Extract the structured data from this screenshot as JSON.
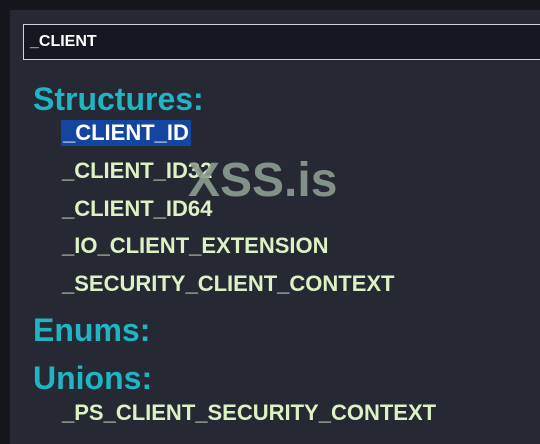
{
  "search": {
    "value": "_CLIENT"
  },
  "sections": {
    "structures": {
      "heading": "Structures:",
      "items": [
        "_CLIENT_ID",
        "_CLIENT_ID32",
        "_CLIENT_ID64",
        "_IO_CLIENT_EXTENSION",
        "_SECURITY_CLIENT_CONTEXT"
      ],
      "selected_index": 0
    },
    "enums": {
      "heading": "Enums:",
      "items": []
    },
    "unions": {
      "heading": "Unions:",
      "items": [
        "_PS_CLIENT_SECURITY_CONTEXT"
      ]
    }
  },
  "watermark": "XSS.is",
  "colors": {
    "background": "#15151d",
    "panel": "#262834",
    "heading": "#1fb5c5",
    "item_text": "#dcf2c4",
    "selection": "#1446a0"
  }
}
